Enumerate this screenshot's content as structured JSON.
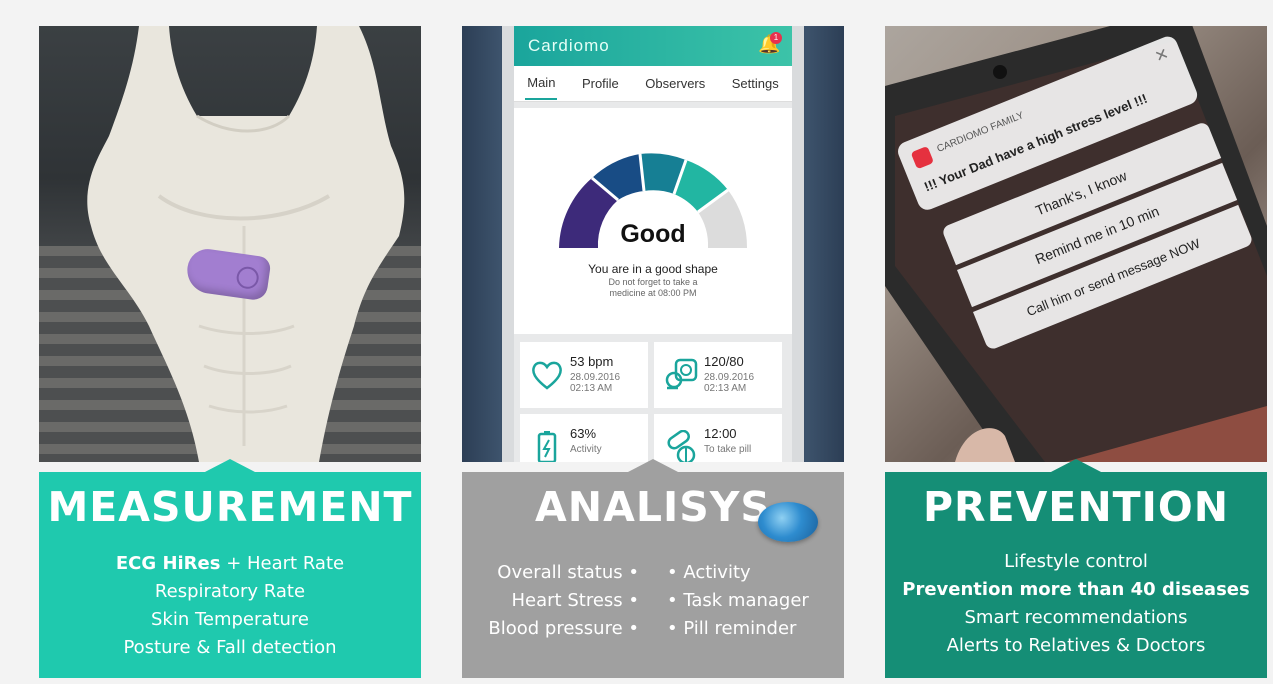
{
  "measurement": {
    "title": "MEASUREMENT",
    "features": [
      {
        "bold": "ECG HiRes",
        "text": " + Heart Rate"
      },
      {
        "bold": "",
        "text": "Respiratory Rate"
      },
      {
        "bold": "",
        "text": "Skin Temperature"
      },
      {
        "bold": "",
        "text": "Posture & Fall detection"
      }
    ],
    "accent": "#1fc9ae"
  },
  "analysis": {
    "title": "ANALISYS",
    "left_features": [
      "Overall status •",
      "Heart Stress •",
      "Blood pressure •"
    ],
    "right_features": [
      "• Activity",
      "• Task manager",
      "• Pill reminder"
    ],
    "accent": "#a0a0a0",
    "app": {
      "title": "Cardiomo",
      "notification_count": "1",
      "tabs": [
        "Main",
        "Profile",
        "Observers",
        "Settings"
      ],
      "status_word": "Good",
      "status_message": "You are in a good shape",
      "status_sub": "Do not forget to take a medicine at 08:00 PM",
      "stats": [
        {
          "value": "53 bpm",
          "date": "28.09.2016",
          "time": "02:13 AM",
          "icon": "heart-icon"
        },
        {
          "value": "120/80",
          "date": "28.09.2016",
          "time": "02:13 AM",
          "icon": "blood-pressure-icon"
        },
        {
          "value": "63%",
          "date": "Activity",
          "time": "",
          "icon": "battery-icon"
        },
        {
          "value": "12:00",
          "date": "To take pill",
          "time": "",
          "icon": "pill-icon"
        }
      ]
    }
  },
  "prevention": {
    "title": "PREVENTION",
    "features": [
      {
        "bold": "",
        "text": "Lifestyle control"
      },
      {
        "bold": "Prevention more than 40 diseases",
        "text": ""
      },
      {
        "bold": "",
        "text": "Smart recommendations"
      },
      {
        "bold": "",
        "text": "Alerts to Relatives & Doctors"
      }
    ],
    "accent": "#158e76",
    "notification": {
      "app_name": "CARDIOMO FAMILY",
      "message": "!!! Your Dad have a high stress level !!!",
      "actions": [
        "Thank's, I know",
        "Remind me in 10 min",
        "Call him or send message NOW"
      ]
    }
  }
}
